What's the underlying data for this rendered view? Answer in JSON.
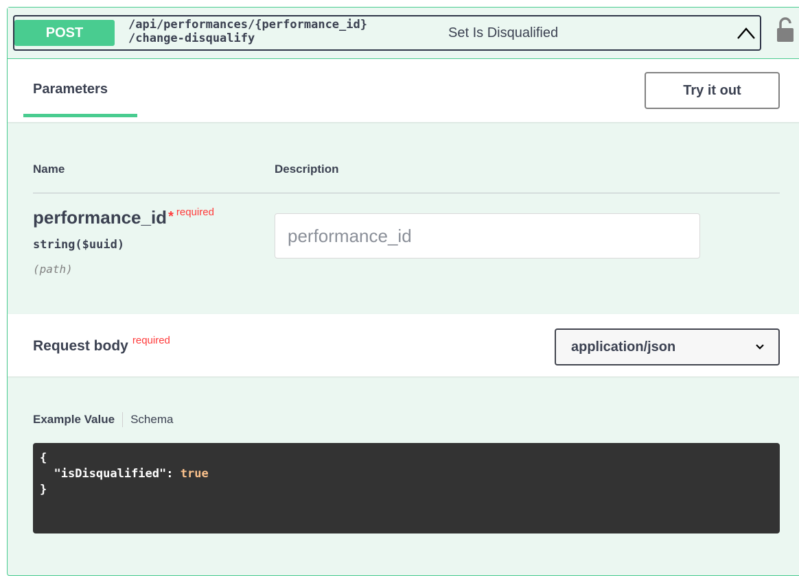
{
  "operation": {
    "method": "POST",
    "path_line1": "/api/performances/{performance_id}",
    "path_line2": "/change-disqualify",
    "summary": "Set Is Disqualified",
    "collapse_icon": "chevron-up-icon",
    "lock_icon": "unlocked-padlock-icon"
  },
  "tabs": {
    "parameters_label": "Parameters",
    "try_it_out_label": "Try it out"
  },
  "parameters_table": {
    "col_name": "Name",
    "col_description": "Description",
    "param": {
      "name": "performance_id",
      "required_star": "*",
      "required_label": "required",
      "type": "string($uuid)",
      "location": "(path)",
      "placeholder": "performance_id"
    }
  },
  "request_body": {
    "title": "Request body",
    "required_label": "required",
    "content_type": "application/json"
  },
  "example": {
    "example_value_label": "Example Value",
    "schema_label": "Schema",
    "open_brace": "{",
    "key": "\"isDisqualified\"",
    "colon": ": ",
    "value": "true",
    "close_brace": "}"
  },
  "colors": {
    "post_green": "#49cc90",
    "block_bg": "#ebf7f1",
    "required_red": "#ff3b3b",
    "code_bg": "#333333"
  }
}
